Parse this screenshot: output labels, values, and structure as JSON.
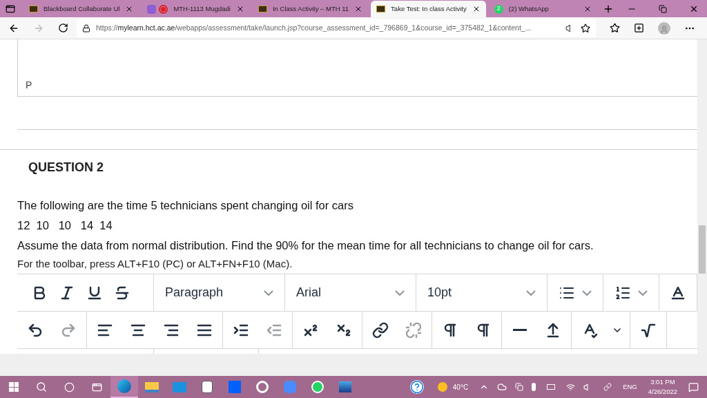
{
  "browser": {
    "tabs": [
      {
        "title": "Blackboard Collaborate Ul",
        "kind": "bb",
        "selected": false
      },
      {
        "title": "MTH-1113 Mugdadi",
        "kind": "recording",
        "selected": false
      },
      {
        "title": "In Class Activity – MTH 11",
        "kind": "bb",
        "selected": false
      },
      {
        "title": "Take Test: In class Activity",
        "kind": "bb",
        "selected": true
      },
      {
        "title": "(2) WhatsApp",
        "kind": "whatsapp",
        "badge": "2",
        "selected": false
      }
    ],
    "url_host": "mylearn.hct.ac.ae",
    "url_scheme": "https://",
    "url_path": "/webapps/assessment/take/launch.jsp?course_assessment_id=_796869_1&course_id=_375482_1&content_..."
  },
  "page": {
    "previous_answer": "P",
    "question_title": "QUESTION 2",
    "question_lines": [
      "The following are the time 5 technicians spent changing oil for cars",
      "12  10   10   14  14",
      "Assume the data from normal distribution. Find the 90% for the mean time for all technicians to change oil for cars."
    ],
    "toolbar_hint": "For the toolbar, press ALT+F10 (PC) or ALT+FN+F10 (Mac).",
    "editor_row1": [
      {
        "kind": "buttons",
        "items": [
          {
            "kind": "bold",
            "disabled": false
          },
          {
            "kind": "italic",
            "disabled": false
          },
          {
            "kind": "underline",
            "disabled": false
          },
          {
            "kind": "strike",
            "disabled": false
          }
        ]
      },
      {
        "kind": "select",
        "value": "Paragraph"
      },
      {
        "kind": "select",
        "value": "Arial"
      },
      {
        "kind": "select",
        "value": "10pt"
      },
      {
        "kind": "bullets"
      },
      {
        "kind": "numbers"
      },
      {
        "kind": "buttons",
        "items": [
          {
            "kind": "textcolor",
            "disabled": false
          }
        ]
      }
    ],
    "editor_row2": [
      [
        {
          "kind": "undo",
          "disabled": false
        },
        {
          "kind": "redo",
          "disabled": true
        }
      ],
      [
        {
          "kind": "alignleft",
          "disabled": false
        },
        {
          "kind": "aligncenter",
          "disabled": false
        },
        {
          "kind": "alignright",
          "disabled": false
        },
        {
          "kind": "justify",
          "disabled": false
        }
      ],
      [
        {
          "kind": "indent",
          "disabled": false
        },
        {
          "kind": "outdent",
          "disabled": true
        }
      ],
      [
        {
          "kind": "superscript",
          "disabled": false
        },
        {
          "kind": "subscript",
          "disabled": false
        }
      ],
      [
        {
          "kind": "link",
          "disabled": false
        },
        {
          "kind": "unlink",
          "disabled": true
        }
      ],
      [
        {
          "kind": "ltr",
          "disabled": false
        },
        {
          "kind": "rtl",
          "disabled": false
        }
      ],
      [
        {
          "kind": "hr",
          "disabled": false
        },
        {
          "kind": "insert",
          "disabled": false
        }
      ],
      [
        {
          "kind": "spellcheck",
          "disabled": false
        },
        {
          "kind": "caret",
          "disabled": false
        }
      ],
      [
        {
          "kind": "math",
          "disabled": false
        }
      ]
    ]
  },
  "taskbar": {
    "apps": [
      {
        "kind": "edge",
        "selected": true
      },
      {
        "kind": "explorer",
        "selected": false
      },
      {
        "kind": "mail",
        "selected": false
      },
      {
        "kind": "amazon",
        "selected": false
      },
      {
        "kind": "dropbox",
        "selected": false
      },
      {
        "kind": "office",
        "selected": false
      },
      {
        "kind": "zoom",
        "selected": false
      },
      {
        "kind": "whatsapp",
        "selected": false
      },
      {
        "kind": "photos",
        "selected": false
      }
    ],
    "temperature": "40°C",
    "language": "ENG",
    "time": "3:01 PM",
    "date": "4/26/2022"
  }
}
